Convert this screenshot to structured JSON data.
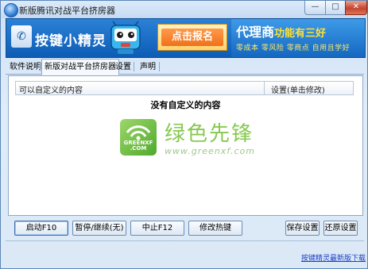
{
  "window": {
    "title": "新版腾讯对战平台挤房器",
    "min_label": "—",
    "max_label": "□",
    "close_label": "✕"
  },
  "banner": {
    "logo_text": "按键小精灵",
    "logo_mark": "✆",
    "signup_label": "点击报名",
    "agent_title": "代理商",
    "agent_title_hl": "功能有三好",
    "agent_sub": "零成本 零风险 零商点 自用且学好"
  },
  "tabs": [
    {
      "label": "软件说明"
    },
    {
      "label": "新版对战平台挤房器"
    },
    {
      "label": "设置"
    },
    {
      "label": "声明"
    }
  ],
  "list": {
    "columns": [
      "可以自定义的内容",
      "设置(单击修改)"
    ],
    "empty_text": "没有自定义的内容"
  },
  "watermark": {
    "logo_text": "GREENXF .COM",
    "cn": "绿色先锋",
    "url": "www.greenxf.com"
  },
  "buttons": {
    "start": "启动F10",
    "pause": "暂停/继续(无)",
    "stop": "中止F12",
    "hotkey": "修改热键",
    "save": "保存设置",
    "restore": "还原设置"
  },
  "footer": {
    "link": "按键精灵最新版下载"
  }
}
